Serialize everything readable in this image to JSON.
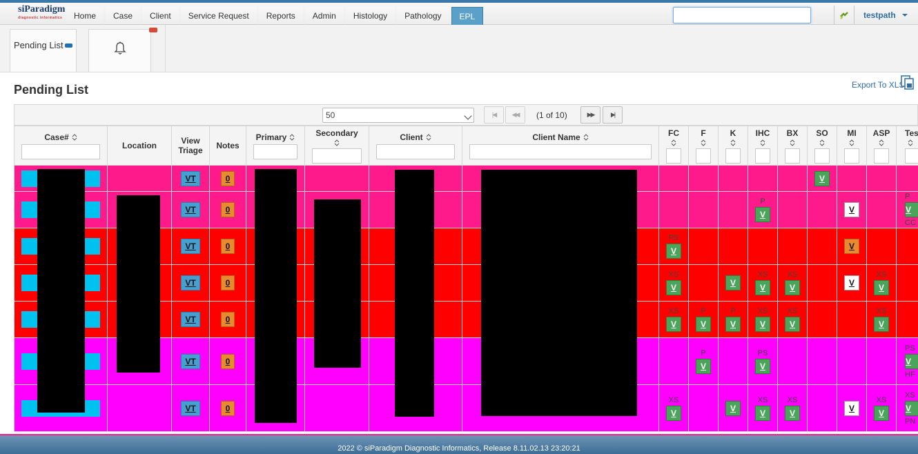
{
  "app": {
    "logo_text": "siParadigm",
    "logo_sub": "diagnostic informatics",
    "nav": [
      "Home",
      "Case",
      "Client",
      "Service Request",
      "Reports",
      "Admin",
      "Histology",
      "Pathology",
      "EPL"
    ],
    "active_nav": "EPL",
    "search_value": "",
    "user": "testpath"
  },
  "tabs": {
    "pending_list": "Pending List"
  },
  "page": {
    "title": "Pending List",
    "export_label": "Export To XLS"
  },
  "paginator": {
    "rows_per_page": "50",
    "page_info": "(1 of 10)",
    "first": "|◀",
    "prev": "◀◀",
    "next": "▶▶",
    "last": "▶|"
  },
  "columns": {
    "case": "Case#",
    "location": "Location",
    "view_triage_1": "View",
    "view_triage_2": "Triage",
    "notes": "Notes",
    "primary": "Primary",
    "secondary": "Secondary",
    "client": "Client",
    "client_name": "Client Name",
    "fc": "FC",
    "f": "F",
    "k": "K",
    "ihc": "IHC",
    "bx": "BX",
    "so": "SO",
    "mi": "MI",
    "asp": "ASP",
    "tes": "Tes"
  },
  "row_buttons": {
    "vt": "VT",
    "notes": "0",
    "v": "V"
  },
  "rows": [
    {
      "color": "pink",
      "notes": "0",
      "tests": {
        "so": {
          "tag": "",
          "style": "g"
        }
      }
    },
    {
      "color": "pink",
      "notes": "0",
      "tests": {
        "ihc": {
          "tag": "P",
          "style": "g"
        },
        "mi": {
          "tag": "",
          "style": "w"
        },
        "tes": {
          "tag": "P",
          "style": "g",
          "under": "CC"
        }
      }
    },
    {
      "color": "red",
      "notes": "0",
      "tests": {
        "fc": {
          "tag": "PS",
          "style": "g"
        },
        "mi": {
          "tag": "",
          "style": "o"
        }
      }
    },
    {
      "color": "red",
      "notes": "0",
      "tests": {
        "fc": {
          "tag": "XS",
          "style": "g"
        },
        "k": {
          "tag": "",
          "style": "g"
        },
        "ihc": {
          "tag": "XS",
          "style": "g"
        },
        "bx": {
          "tag": "XS",
          "style": "g"
        },
        "mi": {
          "tag": "",
          "style": "w"
        },
        "asp": {
          "tag": "XS",
          "style": "g"
        }
      }
    },
    {
      "color": "red",
      "notes": "0",
      "tests": {
        "fc": {
          "tag": "XS",
          "style": "g"
        },
        "f": {
          "tag": "P",
          "style": "g"
        },
        "k": {
          "tag": "P",
          "style": "g"
        },
        "ihc": {
          "tag": "XS",
          "style": "g"
        },
        "bx": {
          "tag": "XS",
          "style": "g"
        },
        "asp": {
          "tag": "XS",
          "style": "g"
        }
      }
    },
    {
      "color": "mag",
      "notes": "0",
      "tests": {
        "f": {
          "tag": "P",
          "style": "g"
        },
        "ihc": {
          "tag": "PS",
          "style": "g"
        },
        "tes": {
          "tag": "PS",
          "style": "g",
          "under": "HF"
        }
      }
    },
    {
      "color": "mag",
      "notes": "0",
      "tests": {
        "fc": {
          "tag": "XS",
          "style": "g"
        },
        "k": {
          "tag": "",
          "style": "g"
        },
        "ihc": {
          "tag": "XS",
          "style": "g"
        },
        "bx": {
          "tag": "XS",
          "style": "g"
        },
        "mi": {
          "tag": "",
          "style": "w"
        },
        "asp": {
          "tag": "XS",
          "style": "g"
        },
        "tes": {
          "tag": "XS",
          "style": "g",
          "under": "PN"
        }
      }
    }
  ],
  "footer": "2022 © siParadigm Diagnostic Informatics, Release 8.11.02.13 23:20:21"
}
